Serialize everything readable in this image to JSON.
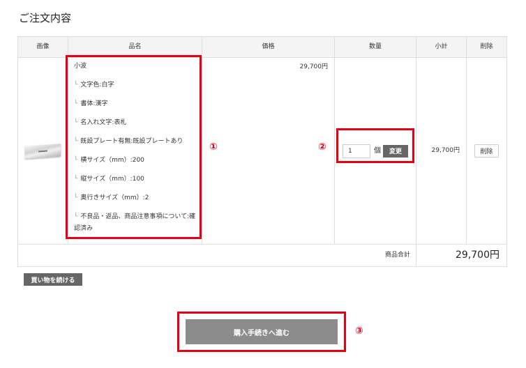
{
  "page": {
    "title": "ご注文内容"
  },
  "cart": {
    "headers": {
      "image": "画像",
      "name": "品名",
      "price": "価格",
      "quantity": "数量",
      "subtotal": "小計",
      "delete": "削除"
    },
    "items": [
      {
        "name": "小波",
        "option_marker": "└",
        "options": [
          "文字色:白字",
          "書体:漢字",
          "名入れ文字:表札",
          "既設プレート有無:既設プレートあり",
          "横サイズ（mm）:200",
          "縦サイズ（mm）:100",
          "奥行きサイズ（mm）:2",
          "不良品・返品、商品注意事項について:確認済み"
        ],
        "price": "29,700円",
        "quantity": "1",
        "quantity_unit": "個",
        "update_button": "変更",
        "subtotal": "29,700円",
        "delete_button": "削除"
      }
    ],
    "total_label": "商品合計",
    "total_value": "29,700円"
  },
  "actions": {
    "continue_shopping": "買い物を続ける",
    "checkout": "購入手続きへ進む"
  },
  "annotations": {
    "markers": [
      "①",
      "②",
      "③"
    ]
  },
  "colors": {
    "annotation_red": "#e60012",
    "header_bg": "#f4f4f4",
    "border": "#dddddd",
    "dark_button": "#666666",
    "checkout_button": "#8c8c8c"
  }
}
